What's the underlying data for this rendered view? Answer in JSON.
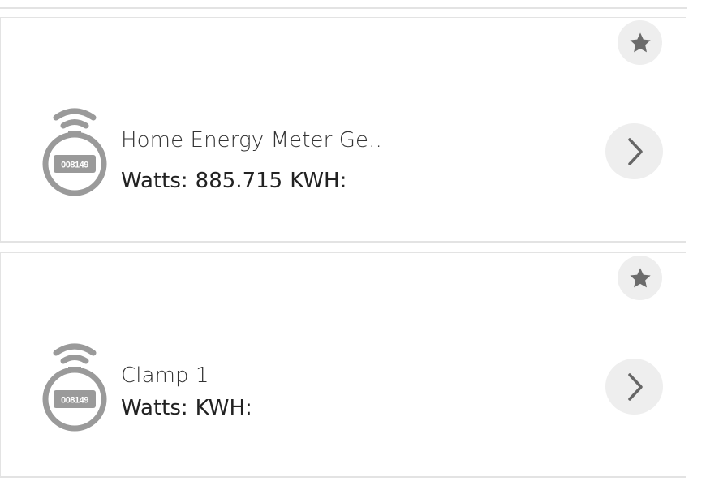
{
  "devices": [
    {
      "name": "Home Energy Meter Ge..",
      "watts_label": "Watts:",
      "watts_value": "885.715",
      "kwh_label": "KWH:",
      "kwh_value": "",
      "meter_display": "008149",
      "icon": "energy-meter-icon"
    },
    {
      "name": "Clamp 1",
      "watts_label": "Watts:",
      "watts_value": "",
      "kwh_label": "KWH:",
      "kwh_value": "",
      "meter_display": "008149",
      "icon": "energy-meter-icon"
    }
  ],
  "icons": {
    "favorite": "star-icon",
    "open": "chevron-right-icon"
  },
  "colors": {
    "icon_gray": "#9a9a9a",
    "button_bg": "#eeeeee",
    "divider": "#e3e3e3",
    "star": "#6b6b6b",
    "chevron": "#666666"
  }
}
